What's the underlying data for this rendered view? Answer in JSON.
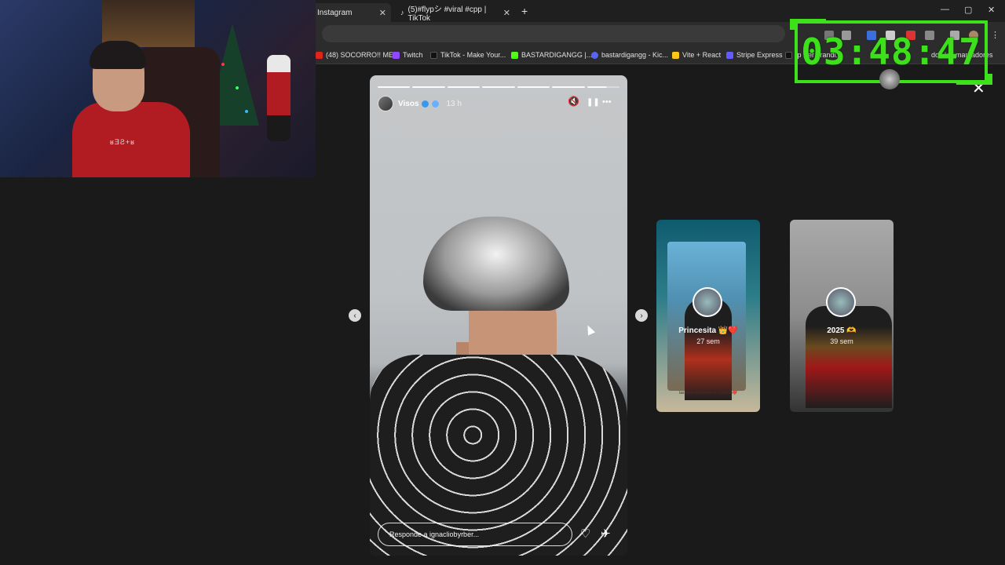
{
  "browser": {
    "tabs": [
      {
        "label": "Instagram",
        "active": true
      },
      {
        "label": "(5)#flypシ #viral #cpp | TikTok",
        "active": false
      }
    ],
    "new_tab": "+",
    "window_controls": {
      "minimize": "—",
      "maximize": "▢",
      "close": "✕"
    },
    "bookmarks": [
      {
        "label": "(48) SOCORRO!! ME...",
        "color": "#e0241a"
      },
      {
        "label": "Twitch",
        "color": "#9146ff"
      },
      {
        "label": "TikTok - Make Your...",
        "color": "#111111"
      },
      {
        "label": "BASTARDIGANGG |...",
        "color": "#53fc18"
      },
      {
        "label": "bastardigangg - Kic...",
        "color": "#5865f2"
      },
      {
        "label": "Vite + React",
        "color": "#ffc517"
      },
      {
        "label": "Stripe Express",
        "color": "#635bff"
      },
      {
        "label": "fp Per arandi...",
        "color": "#111111"
      },
      {
        "label": "dos los marcadores",
        "color": "#777777"
      }
    ]
  },
  "webcam": {
    "shirt_text": "ʁƎƧ+ʁ"
  },
  "story": {
    "username": "Visos",
    "time_ago": "13 h",
    "progress_total": 7,
    "progress_done": 6,
    "reply_placeholder": "Responde a ignacliobyrber...",
    "mute_icon": "🔇",
    "pause_icon": "❚❚",
    "more_icon": "•••",
    "like_icon": "♡",
    "share_icon": "✈"
  },
  "nav": {
    "prev": "‹",
    "next": "›",
    "close": "✕"
  },
  "previews": [
    {
      "title": "Princesita 👑❤️",
      "sub": "27 sem",
      "caption": "las amo mis bebes mi corazón❤️"
    },
    {
      "title": "2025 🫶",
      "sub": "39 sem"
    }
  ],
  "timer": {
    "value": "03:48:47",
    "color": "#3ee01c"
  }
}
